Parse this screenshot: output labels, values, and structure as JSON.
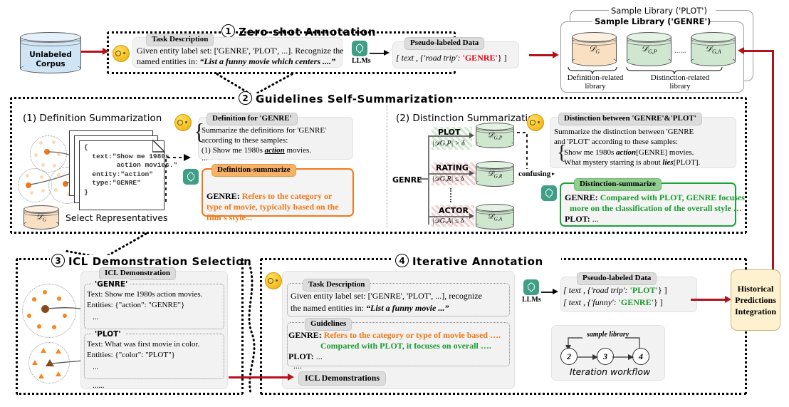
{
  "steps": {
    "s1": {
      "num": "1",
      "title": "Zero-shot Annotation"
    },
    "s2": {
      "num": "2",
      "title": "Guidelines Self-Summarization"
    },
    "s3": {
      "num": "3",
      "title": "ICL Demonstration Selection"
    },
    "s4": {
      "num": "4",
      "title": "Iterative Annotation"
    }
  },
  "corpus": {
    "line1": "Unlabeled",
    "line2": "Corpus"
  },
  "step1": {
    "task_tag": "Task Description",
    "task_line1": "Given entity label set: ['GENRE', 'PLOT', ...]. Recognize the",
    "task_line2_prefix": "named entities in:",
    "task_line2_quote": "“List a funny movie which centers ....”",
    "llm_label": "LLMs",
    "pseudo_tag": "Pseudo-labeled Data",
    "pseudo_prefix": "[ text , {'road trip': ",
    "pseudo_label": "'GENRE'",
    "pseudo_suffix": "} ]"
  },
  "library": {
    "outer_title": "Sample Library ('PLOT')",
    "inner_title": "Sample Library ('GENRE')",
    "cyl_def": "𝒟",
    "cyl_def_sub": "G",
    "cyl_p": "G,P",
    "cyl_a": "G,A",
    "ellipsis": "......",
    "def_caption_l1": "Definition-related",
    "def_caption_l2": "library",
    "dist_caption_l1": "Distinction-related",
    "dist_caption_l2": "library"
  },
  "step2": {
    "sub1": "(1) Definition Summarization",
    "sub2": "(2) Distinction Summarization",
    "select_rep": "Select Representatives",
    "dg_label": "G",
    "doc_code": "{\n  text:\"Show me 1980s\n        action movies.\"\n  entity:\"action\"\n  type:\"GENRE\"\n}",
    "def_tag": "Definition for 'GENRE'",
    "def_l1": "Summarize the definitions for 'GENRE'",
    "def_l2": "according to these samples:",
    "def_l3_a": "(1) Show me 1980s ",
    "def_l3_b": "action",
    "def_l3_c": " movies.",
    "def_l4": "...",
    "defsum_tag": "Definition-summarize",
    "defsum_label": "GENRE",
    "defsum_l1": "Refers to the category or type of",
    "defsum_l2": "movie, typically based on the film's style...",
    "branch_root": "GENRE",
    "branches": [
      {
        "name": "PLOT",
        "cond": "|𝒟G,P| > δ",
        "cyl": "G,P",
        "hatch": "green"
      },
      {
        "name": "RATING",
        "cond": "|𝒟G,R| ≤ δ",
        "cyl": "G,R",
        "hatch": "red"
      },
      {
        "name": "ACTOR",
        "cond": "|𝒟G,A| ≤ δ",
        "cyl": "G,A",
        "hatch": "red"
      }
    ],
    "confusing": "confusing",
    "dist_tag": "Distinction between 'GENRE'&'PLOT'",
    "dist_l1": "Summarize the distinction between 'GENRE",
    "dist_l2": "and 'PLOT' according to these samples:",
    "dist_l3_a": "Show me 1980s  ",
    "dist_l3_b": "action",
    "dist_l3_c": "[GENRE]  movies.",
    "dist_l4_a": "What mystery starring is about  ",
    "dist_l4_b": "lies",
    "dist_l4_c": "[PLOT].",
    "distsum_tag": "Distinction-summarize",
    "distsum_label_genre": "GENRE",
    "distsum_l1": "Compared with PLOT, GENRE focuses",
    "distsum_l2": "more on the classification of the overall style …",
    "distsum_label_plot": "PLOT",
    "distsum_l3": "..."
  },
  "step3": {
    "icl_tag": "ICL Demonstration",
    "card1": {
      "label": "'GENRE'",
      "text": "Text: Show me 1980s action movies.",
      "entities": "Entities: {\"action\": \"GENRE\"}",
      "more": "..."
    },
    "card2": {
      "label": "'PLOT'",
      "text": "Text: What was first movie in color.",
      "entities": "Entities: {\"color\": \"PLOT\"}",
      "more": "..."
    },
    "tail": "......"
  },
  "step4": {
    "task_tag": "Task Description",
    "task_l1": "Given entity label set: ['GENRE', 'PLOT', ...], recognize",
    "task_l2_prefix": "the named entities in:",
    "task_l2_quote": "“List a funny movie  ...”",
    "guide_tag": "Guidelines",
    "guide_label": "GENRE",
    "guide_l1": "Refers to the category or type of movie based ….",
    "guide_l2": "Compared with PLOT, it focuses on overall ….",
    "guide_plot": "PLOT",
    "guide_plot_val": "...",
    "guide_more": "....",
    "icl_demos_tag": "ICL Demonstrations",
    "llm_label": "LLMs",
    "pseudo_tag": "Pseudo-labeled Data",
    "row1_prefix": "[ text , {'road trip': ",
    "row1_label": "'PLOT'",
    "row1_suffix": "} ]",
    "row2_prefix": "[ text , {'funny': ",
    "row2_label": "'GENRE'",
    "row2_suffix": "} ]",
    "workflow_caption": "sample library",
    "workflow_nodes": [
      "2",
      "3",
      "4"
    ],
    "workflow_title": "Iteration workflow"
  },
  "hpi": {
    "l1": "Historical",
    "l2": "Predictions",
    "l3": "Integration"
  },
  "colors": {
    "red_arrow": "#b4121b",
    "orange": "#f07818",
    "green": "#19a33a",
    "llm_teal": "#3f9f86",
    "yellow_box": "#fdf1cf",
    "corpus_blue": "#cfe4f5",
    "cyl_peach": "#fae0c3",
    "cyl_green": "#cfe6cf"
  }
}
